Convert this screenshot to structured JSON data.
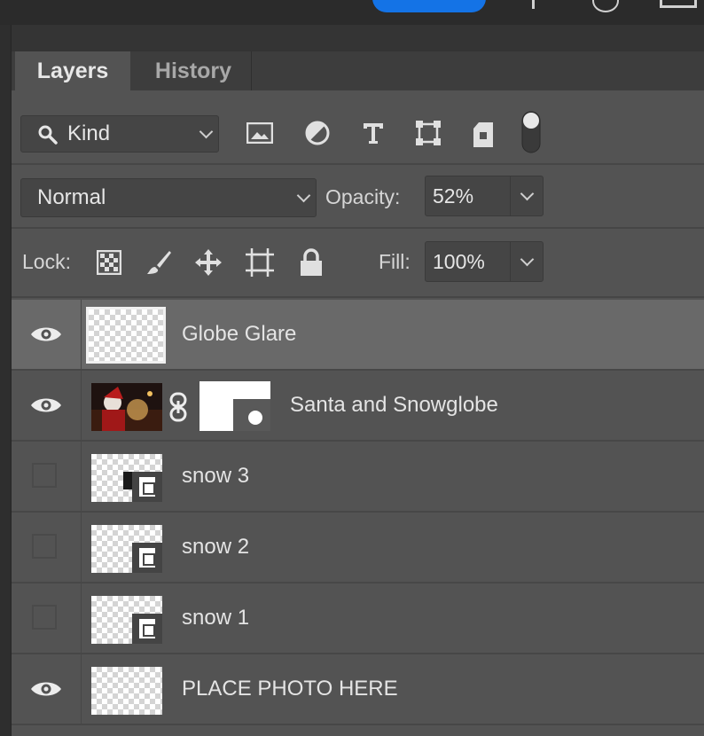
{
  "tabs": [
    {
      "label": "Layers"
    },
    {
      "label": "History"
    }
  ],
  "filter": {
    "kind_label": "Kind",
    "icons": [
      "image-filter-icon",
      "adjustment-filter-icon",
      "type-filter-icon",
      "shape-filter-icon",
      "smart-object-filter-icon",
      "filter-toggle-icon"
    ]
  },
  "blend": {
    "mode": "Normal",
    "opacity_label": "Opacity:",
    "opacity_value": "52%"
  },
  "lock": {
    "label": "Lock:",
    "icons": [
      "lock-transparent-pixels-icon",
      "lock-image-pixels-icon",
      "lock-position-icon",
      "lock-artboard-icon",
      "lock-all-icon"
    ],
    "fill_label": "Fill:",
    "fill_value": "100%"
  },
  "layers": [
    {
      "name": "Globe Glare",
      "visible": true,
      "selected": true,
      "type": "pixel"
    },
    {
      "name": "Santa and Snowglobe",
      "visible": true,
      "selected": false,
      "type": "masked-photo"
    },
    {
      "name": "snow 3",
      "visible": false,
      "selected": false,
      "type": "smart-object"
    },
    {
      "name": "snow 2",
      "visible": false,
      "selected": false,
      "type": "smart-object"
    },
    {
      "name": "snow 1",
      "visible": false,
      "selected": false,
      "type": "smart-object"
    },
    {
      "name": "PLACE PHOTO HERE",
      "visible": true,
      "selected": false,
      "type": "pixel"
    }
  ],
  "colors": {
    "panel": "#535353",
    "selected_row": "#696969",
    "accent": "#1473e6"
  }
}
